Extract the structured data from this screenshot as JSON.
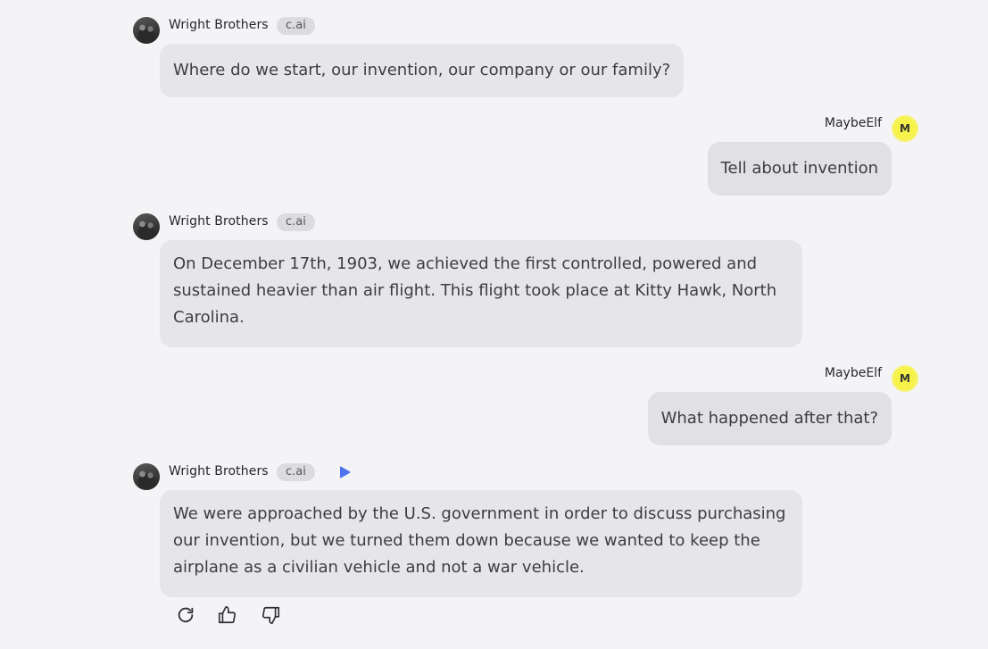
{
  "bot": {
    "name": "Wright Brothers",
    "badge": "c.ai"
  },
  "user": {
    "name": "MaybeElf",
    "initial": "M"
  },
  "messages": [
    {
      "role": "bot",
      "text": "Where do we start, our invention, our company or our family?"
    },
    {
      "role": "user",
      "text": "Tell about invention"
    },
    {
      "role": "bot",
      "text": "On December 17th, 1903, we achieved the first controlled, powered and sustained heavier than air flight. This flight took place at Kitty Hawk, North Carolina."
    },
    {
      "role": "user",
      "text": "What happened after that?"
    },
    {
      "role": "bot",
      "text": "We were approached by the U.S. government in order to discuss purchasing our invention, but we turned them down because we wanted to keep the airplane as a civilian vehicle and not a war vehicle."
    }
  ],
  "actions": {
    "icons": [
      "refresh-icon",
      "thumbs-up-icon",
      "thumbs-down-icon",
      "play-icon"
    ]
  },
  "colors": {
    "background": "#f4f4f6",
    "bot_bubble": "#e6e6ea",
    "user_bubble": "#e0e0e5",
    "play_accent": "#4f73f0",
    "user_avatar": "#f7f24a"
  }
}
